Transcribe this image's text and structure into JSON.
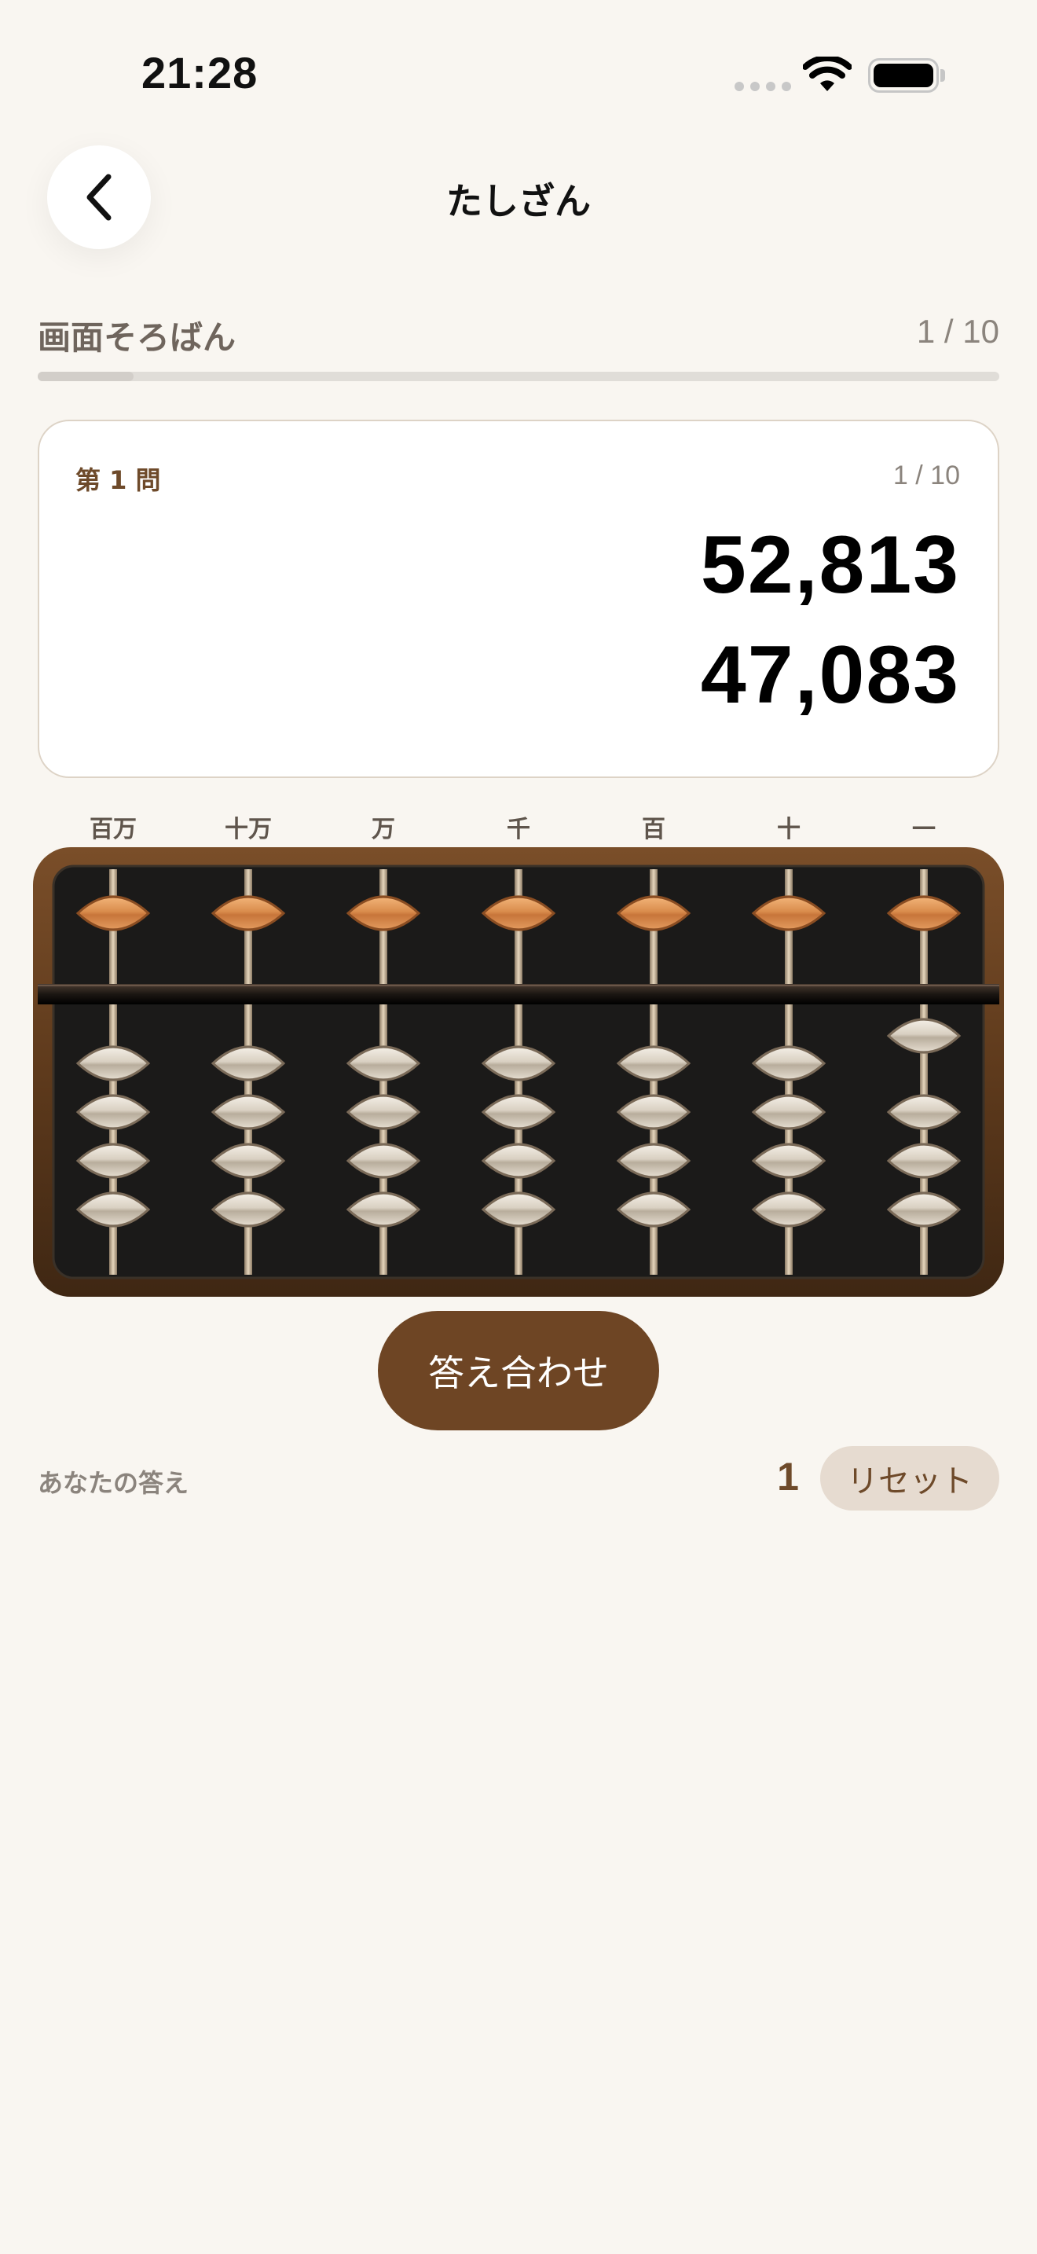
{
  "status_bar": {
    "time": "21:28"
  },
  "nav": {
    "title": "たしざん"
  },
  "header": {
    "mode_label": "画面そろばん",
    "progress_text": "1 / 10",
    "progress": 0.1
  },
  "problem": {
    "number_label": "第 1 問",
    "count": "1 / 10",
    "operands": [
      "52,813",
      "47,083"
    ]
  },
  "abacus": {
    "place_labels": [
      "百万",
      "十万",
      "万",
      "千",
      "百",
      "十",
      "一"
    ],
    "digits": [
      0,
      0,
      0,
      0,
      0,
      0,
      1
    ],
    "colors": {
      "frame": "#6b4322",
      "board": "#1b1a19",
      "upper_bead": "#d48a4e",
      "lower_bead": "#d6cec2",
      "beam": "#2a211b"
    }
  },
  "actions": {
    "check_label": "答え合わせ",
    "reset_label": "リセット"
  },
  "answer": {
    "label": "あなたの答え",
    "value": "1"
  }
}
